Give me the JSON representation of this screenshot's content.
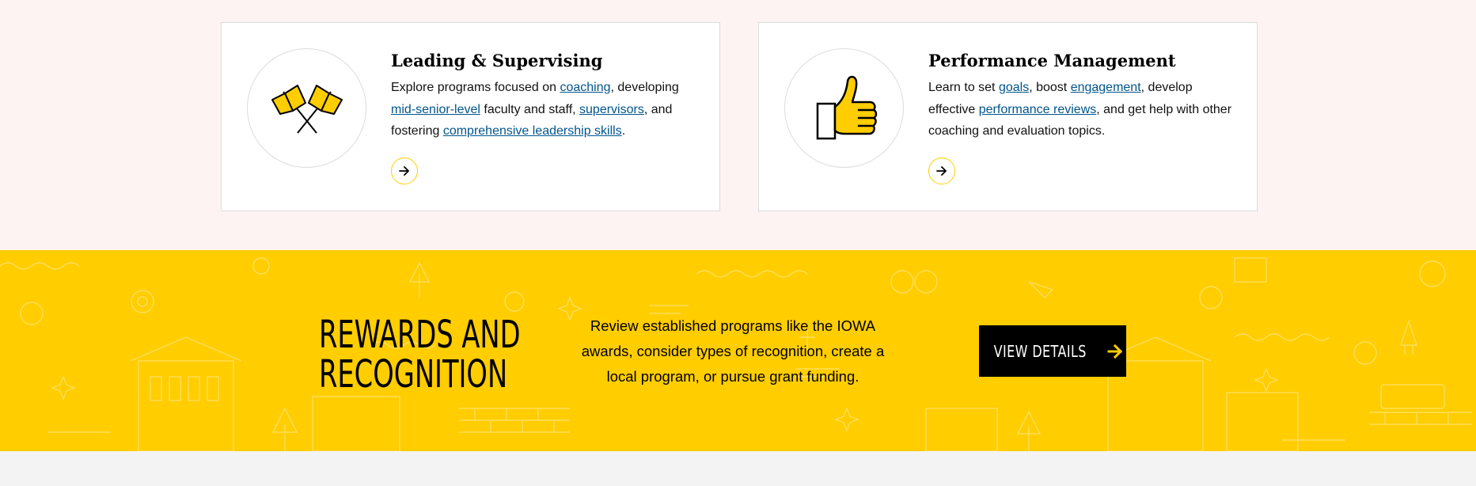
{
  "cards": [
    {
      "icon": "flags-icon",
      "title": "Leading & Supervising",
      "text": {
        "t1": "Explore programs focused on ",
        "l1": "coaching",
        "t2": ", developing ",
        "l2": "mid-senior-level",
        "t3": " faculty and staff, ",
        "l3": "supervisors",
        "t4": ", and fostering ",
        "l4": "comprehensive leadership skills",
        "t5": "."
      },
      "arrow_icon": "arrow-right-icon"
    },
    {
      "icon": "thumbs-up-icon",
      "title": "Performance Management",
      "text": {
        "t1": "Learn to set ",
        "l1": "goals",
        "t2": ", boost ",
        "l2": "engagement",
        "t3": ", develop effective ",
        "l3": "performance reviews",
        "t4": ", and get help with other coaching and evaluation topics."
      },
      "arrow_icon": "arrow-right-icon"
    }
  ],
  "promo": {
    "title_line1": "REWARDS AND",
    "title_line2": "RECOGNITION",
    "description": "Review established programs like the IOWA awards, consider types of recognition, create a local program, or pursue grant funding.",
    "button_label": "VIEW DETAILS",
    "button_icon": "arrow-right-icon"
  },
  "colors": {
    "accent_gold": "#ffcd00",
    "link_blue": "#00558c",
    "top_background": "#fdf3f2",
    "bottom_background": "#f3f3f3"
  }
}
